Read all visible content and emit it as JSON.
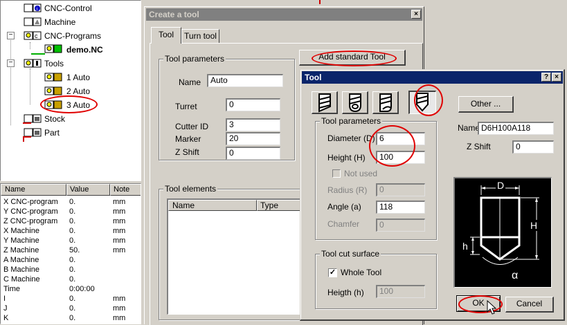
{
  "tree": {
    "items": [
      {
        "label": "CNC-Control",
        "icon": "cnc-control-icon"
      },
      {
        "label": "Machine",
        "icon": "machine-icon"
      },
      {
        "label": "CNC-Programs",
        "icon": "cnc-programs-icon"
      },
      {
        "label": "demo.NC",
        "icon": "program-file-icon"
      },
      {
        "label": "Tools",
        "icon": "tools-icon"
      },
      {
        "label": "1 Auto",
        "icon": "tool-icon"
      },
      {
        "label": "2 Auto",
        "icon": "tool-icon"
      },
      {
        "label": "3 Auto",
        "icon": "tool-icon"
      },
      {
        "label": "Stock",
        "icon": "stock-icon"
      },
      {
        "label": "Part",
        "icon": "part-icon"
      }
    ],
    "expander": "−"
  },
  "listview": {
    "headers": [
      "Name",
      "Value",
      "Note"
    ],
    "rows": [
      [
        "X CNC-program",
        "0.",
        "mm"
      ],
      [
        "Y CNC-program",
        "0.",
        "mm"
      ],
      [
        "Z CNC-program",
        "0.",
        "mm"
      ],
      [
        "X Machine",
        "0.",
        "mm"
      ],
      [
        "Y Machine",
        "0.",
        "mm"
      ],
      [
        "Z Machine",
        "50.",
        "mm"
      ],
      [
        "A Machine",
        "0.",
        ""
      ],
      [
        "B Machine",
        "0.",
        ""
      ],
      [
        "C Machine",
        "0.",
        ""
      ],
      [
        "Time",
        "0:00:00",
        ""
      ],
      [
        "I",
        "0.",
        "mm"
      ],
      [
        "J",
        "0.",
        "mm"
      ],
      [
        "K",
        "0.",
        "mm"
      ]
    ]
  },
  "create_dialog": {
    "title": "Create a tool",
    "close": "×",
    "tabs": [
      "Tool",
      "Turn tool"
    ],
    "params_group": "Tool parameters",
    "add_standard": "Add standard Tool",
    "name_label": "Name",
    "name_value": "Auto",
    "turret_label": "Turret",
    "turret_value": "0",
    "cutter_label": "Cutter ID",
    "cutter_value": "3",
    "marker_label": "Marker",
    "marker_value": "20",
    "zshift_label": "Z Shift",
    "zshift_value": "0",
    "elements_group": "Tool elements",
    "elements_headers": [
      "Name",
      "Type"
    ]
  },
  "tool_dialog": {
    "title": "Tool",
    "help": "?",
    "close": "×",
    "other_button": "Other ...",
    "name_label": "Name",
    "name_value": "D6H100A118",
    "zshift_label": "Z Shift",
    "zshift_value": "0",
    "params_group": "Tool parameters",
    "diameter_label": "Diameter (D)",
    "diameter_value": "6",
    "height_label": "Height (H)",
    "height_value": "100",
    "not_used_label": "Not used",
    "radius_label": "Radius (R)",
    "radius_value": "0",
    "angle_label": "Angle (a)",
    "angle_value": "118",
    "chamfer_label": "Chamfer",
    "chamfer_value": "0",
    "surface_group": "Tool cut surface",
    "whole_tool_label": "Whole Tool",
    "heigth_label": "Heigth (h)",
    "heigth_value": "100",
    "diagram_d": "D",
    "diagram_h_big": "H",
    "diagram_h_small": "h",
    "diagram_alpha": "α",
    "ok_button": "OK",
    "cancel_button": "Cancel"
  },
  "colors": {
    "highlight_ellipse": "#e00000",
    "title_active": "#0a246a",
    "title_inactive": "#808080"
  }
}
